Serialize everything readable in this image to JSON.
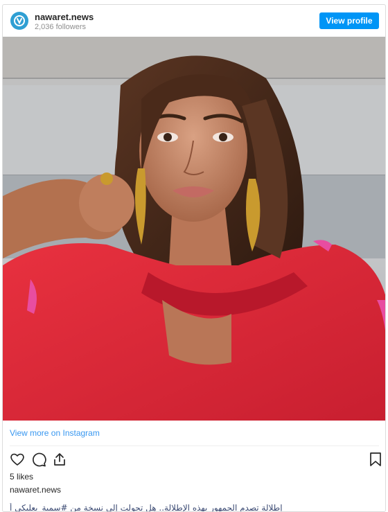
{
  "header": {
    "username": "nawaret.news",
    "followers": "2,036 followers",
    "view_profile_label": "View profile",
    "avatar_icon": "nawaret-logo-icon"
  },
  "post": {
    "image_icon": "woman-in-red-dress-photo",
    "view_more_label": "View more on Instagram",
    "likes": "5 likes",
    "caption_user": "nawaret.news",
    "caption_text": "إطلالة تصدم الجمهور بهذه الإطلالة.. هل تحولت إلى نسخة من #سمية_بعلبكي أ"
  },
  "actions": {
    "like_icon": "heart-icon",
    "comment_icon": "comment-icon",
    "share_icon": "share-icon",
    "save_icon": "bookmark-icon"
  },
  "colors": {
    "accent": "#0095f6",
    "link": "#3897f0",
    "dress": "#e2283a"
  }
}
